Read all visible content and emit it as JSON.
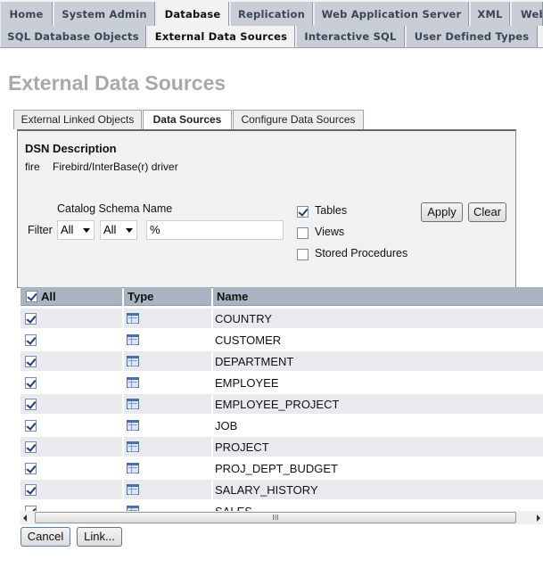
{
  "top_tabs": [
    "Home",
    "System Admin",
    "Database",
    "Replication",
    "Web Application Server",
    "XML",
    "Web"
  ],
  "sub_tabs": [
    "SQL Database Objects",
    "External Data Sources",
    "Interactive SQL",
    "User Defined Types"
  ],
  "page_title": "External Data Sources",
  "inner_tabs": [
    "External Linked Objects",
    "Data Sources",
    "Configure Data Sources"
  ],
  "dsn": {
    "header": "DSN Description",
    "name": "fire",
    "description": "Firebird/InterBase(r) driver"
  },
  "filter": {
    "headers": "Catalog Schema Name",
    "label": "Filter",
    "catalog": "All",
    "schema": "All",
    "name_value": "%"
  },
  "options": {
    "tables": "Tables",
    "views": "Views",
    "stored_procedures": "Stored Procedures",
    "tables_checked": true,
    "views_checked": false,
    "sp_checked": false
  },
  "buttons": {
    "apply": "Apply",
    "clear": "Clear",
    "cancel": "Cancel",
    "link": "Link..."
  },
  "grid": {
    "col_all": "All",
    "col_type": "Type",
    "col_name": "Name",
    "rows": [
      "COUNTRY",
      "CUSTOMER",
      "DEPARTMENT",
      "EMPLOYEE",
      "EMPLOYEE_PROJECT",
      "JOB",
      "PROJECT",
      "PROJ_DEPT_BUDGET",
      "SALARY_HISTORY",
      "SALES"
    ]
  },
  "scrollbar_grip": "III",
  "colors": {
    "header_bg": "#a9b4c2",
    "row_odd": "#e8eaee",
    "row_even": "#ffffff",
    "title": "#a9a9a9"
  }
}
